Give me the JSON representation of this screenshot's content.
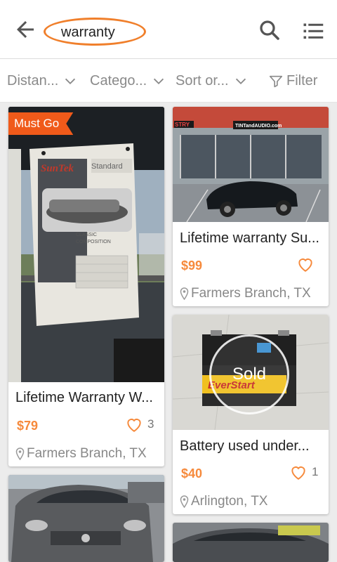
{
  "search": {
    "query": "warranty"
  },
  "filters": [
    {
      "label": "Distan..."
    },
    {
      "label": "Catego..."
    },
    {
      "label": "Sort or..."
    },
    {
      "label": "Filter"
    }
  ],
  "listings": [
    {
      "badge": "Must Go",
      "title": "Lifetime Warranty W...",
      "price": "$79",
      "likes": "3",
      "location": "Farmers Branch, TX"
    },
    {
      "title": "Lifetime warranty Su...",
      "price": "$99",
      "likes": "",
      "location": "Farmers Branch, TX",
      "photo_sign_left": "STRY",
      "photo_sign_right": "TINTandAUDIO.com"
    },
    {
      "title": "Battery used under...",
      "price": "$40",
      "likes": "1",
      "location": "Arlington, TX",
      "status": "Sold"
    },
    {
      "title": "",
      "price": "",
      "location": ""
    },
    {
      "title": "",
      "price": "",
      "location": ""
    }
  ],
  "photo_text": {
    "suntek_brand": "SunTek",
    "suntek_standard": "Standard",
    "suntek_line1": "CLASSIC",
    "suntek_line2": "COMPOSITION",
    "battery_brand": "EverStart"
  },
  "colors": {
    "accent": "#f68a3c",
    "badge": "#f05a1a",
    "search_ring": "#f07f2b"
  }
}
